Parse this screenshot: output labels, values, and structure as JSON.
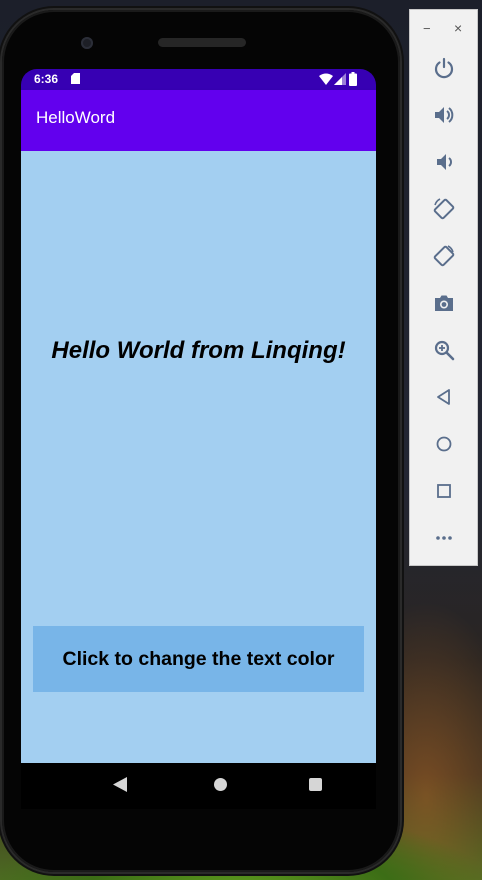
{
  "statusbar": {
    "time": "6:36"
  },
  "app": {
    "title": "HelloWord"
  },
  "main": {
    "hello_text": "Hello World from Linqing!",
    "button_label": "Click to change the text color"
  },
  "emulator_toolbar": {
    "window_controls": {
      "minimize": "−",
      "close": "×"
    },
    "buttons": [
      "power-icon",
      "volume-up-icon",
      "volume-down-icon",
      "rotate-left-icon",
      "rotate-right-icon",
      "camera-icon",
      "zoom-icon",
      "back-icon",
      "home-icon",
      "overview-icon",
      "more-icon"
    ]
  },
  "colors": {
    "statusbar": "#3700b3",
    "appbar": "#6200ee",
    "content_background": "#a3cff1",
    "button_background": "#78b5e8",
    "toolbar_icon": "#5a6e8c"
  }
}
